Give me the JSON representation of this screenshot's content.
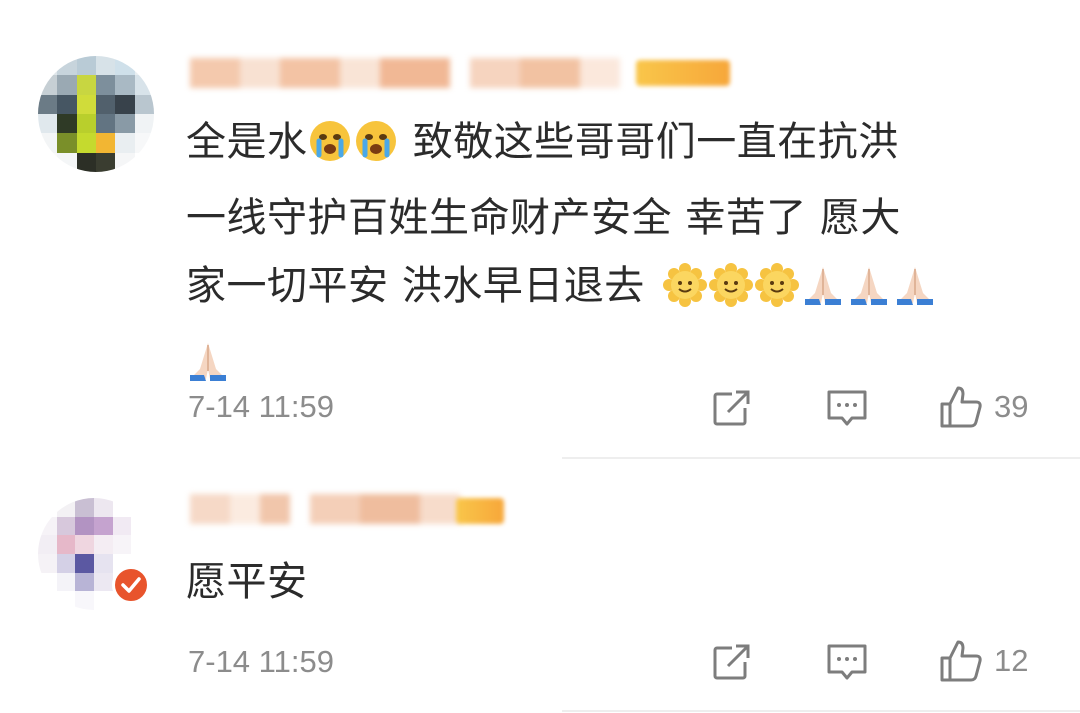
{
  "comments": [
    {
      "line1_prefix": "全是水",
      "line1_suffix": " 致敬这些哥哥们一直在抗洪",
      "line2": "一线守护百姓生命财产安全 幸苦了 愿大",
      "line3": "家一切平安 洪水早日退去",
      "emojis": [
        "crying-emoji",
        "crying-emoji",
        "smile-flower-emoji",
        "smile-flower-emoji",
        "smile-flower-emoji",
        "pray-emoji",
        "pray-emoji",
        "pray-emoji",
        "pray-emoji"
      ],
      "time": "7-14 11:59",
      "likes": "39"
    },
    {
      "text": "愿平安",
      "time": "7-14 11:59",
      "likes": "12",
      "verified": true
    }
  ],
  "icons": {
    "share": "share-icon",
    "reply": "reply-icon",
    "like": "thumbs-up-icon"
  },
  "colors": {
    "text": "#2b2b2b",
    "meta": "#8c8c8c",
    "verified_badge": "#e8542c"
  }
}
